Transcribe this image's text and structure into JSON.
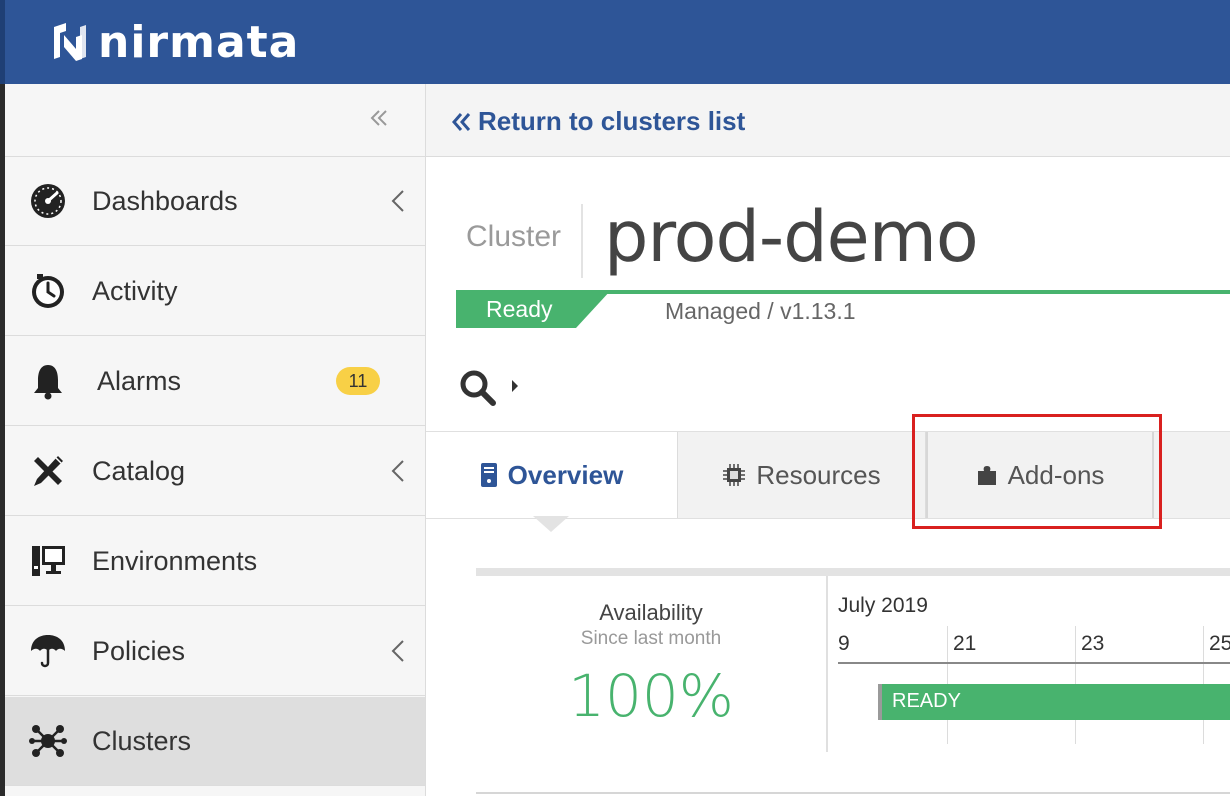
{
  "brand": {
    "name": "nirmata"
  },
  "sidebar": {
    "items": [
      {
        "label": "Dashboards",
        "icon": "dashboard-gauge-icon",
        "has_submenu": true
      },
      {
        "label": "Activity",
        "icon": "clock-icon",
        "has_submenu": false
      },
      {
        "label": "Alarms",
        "icon": "bell-icon",
        "badge": "11",
        "has_submenu": false
      },
      {
        "label": "Catalog",
        "icon": "tools-icon",
        "has_submenu": true
      },
      {
        "label": "Environments",
        "icon": "monitor-icon",
        "has_submenu": false
      },
      {
        "label": "Policies",
        "icon": "umbrella-icon",
        "has_submenu": true
      },
      {
        "label": "Clusters",
        "icon": "cluster-network-icon",
        "has_submenu": false,
        "active": true
      }
    ]
  },
  "header": {
    "return_label": "Return to clusters list"
  },
  "cluster": {
    "kind_label": "Cluster",
    "name": "prod-demo",
    "status": "Ready",
    "meta": "Managed / v1.13.1"
  },
  "tabs": [
    {
      "label": "Overview",
      "icon": "server-icon",
      "active": true
    },
    {
      "label": "Resources",
      "icon": "chip-icon",
      "active": false
    },
    {
      "label": "Add-ons",
      "icon": "puzzle-icon",
      "active": false,
      "highlighted": true
    }
  ],
  "availability": {
    "title": "Availability",
    "subtitle": "Since last month",
    "value": "100%"
  },
  "timeline": {
    "month": "July 2019",
    "ticks": [
      "9",
      "21",
      "23",
      "25"
    ],
    "bar_label": "READY"
  },
  "colors": {
    "brand_blue": "#2e5597",
    "ready_green": "#48b36e",
    "badge_yellow": "#f8d046",
    "highlight_red": "#d9201f"
  }
}
